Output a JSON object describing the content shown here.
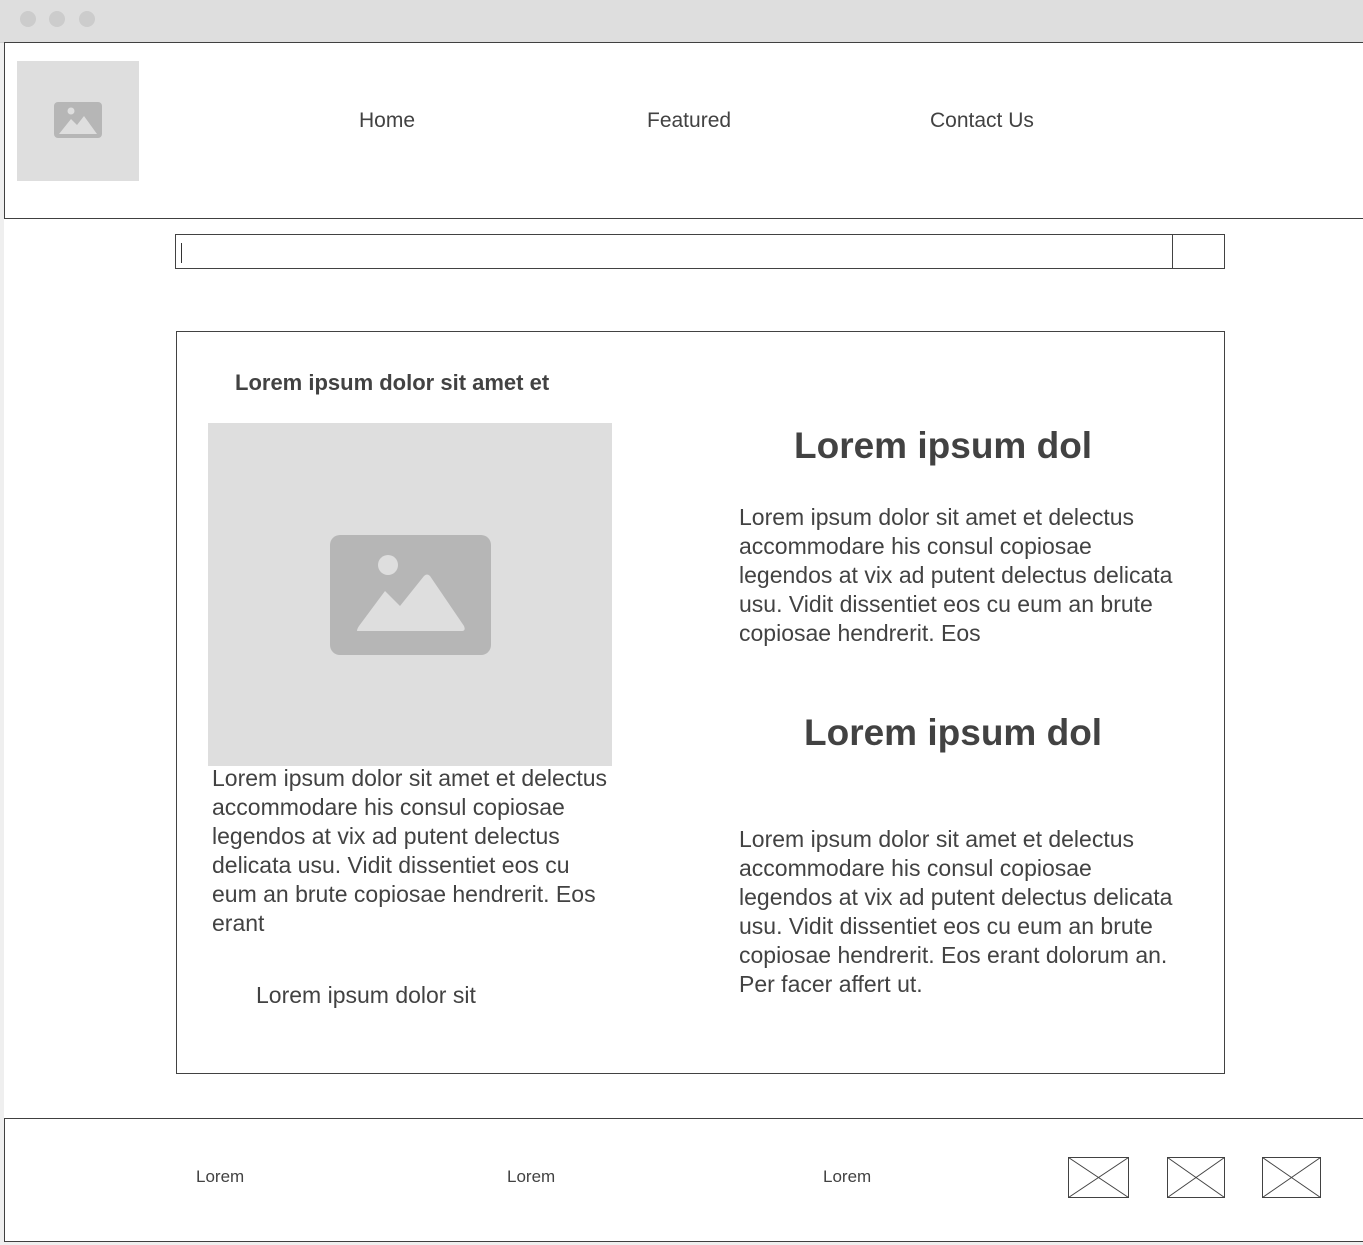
{
  "window": {
    "controls": [
      "close",
      "minimize",
      "maximize"
    ]
  },
  "header": {
    "logo_icon": "image-placeholder-icon",
    "nav": [
      {
        "label": "Home"
      },
      {
        "label": "Featured"
      },
      {
        "label": "Contact Us"
      }
    ]
  },
  "search": {
    "value": ""
  },
  "content": {
    "left": {
      "title": "Lorem ipsum dolor sit amet et",
      "image_icon": "image-placeholder-icon",
      "text": "Lorem ipsum dolor sit amet et delectus accommodare his consul copiosae legendos at vix ad putent delectus delicata usu. Vidit dissentiet eos cu eum an brute copiosae hendrerit. Eos erant",
      "caption": "Lorem ipsum dolor sit"
    },
    "right": {
      "heading_1": "Lorem ipsum dol",
      "text_1": "Lorem ipsum dolor sit amet et delectus accommodare his consul copiosae legendos at vix ad putent delectus delicata usu. Vidit dissentiet eos cu eum an brute copiosae hendrerit. Eos",
      "heading_2": "Lorem ipsum dol",
      "text_2": "Lorem ipsum dolor sit amet et delectus accommodare his consul copiosae legendos at vix ad putent delectus delicata usu. Vidit dissentiet eos cu eum an brute copiosae hendrerit. Eos erant dolorum an. Per facer affert ut."
    }
  },
  "footer": {
    "links": [
      {
        "label": "Lorem"
      },
      {
        "label": "Lorem"
      },
      {
        "label": "Lorem"
      }
    ],
    "social_icons": [
      "placeholder-icon",
      "placeholder-icon",
      "placeholder-icon"
    ]
  },
  "colors": {
    "text": "#424242",
    "placeholder_fill": "#dedede",
    "placeholder_icon": "#b6b6b6",
    "border": "#424242",
    "titlebar": "#dedede"
  }
}
